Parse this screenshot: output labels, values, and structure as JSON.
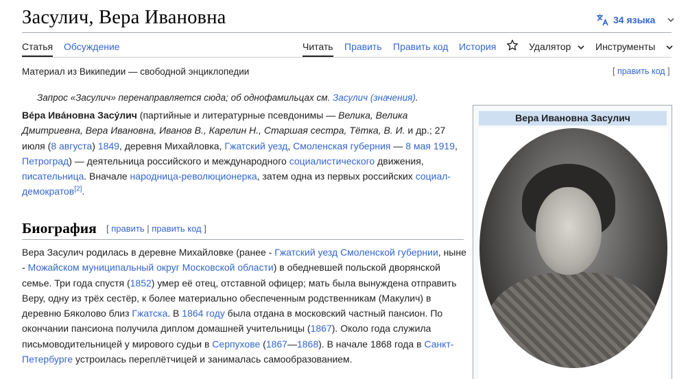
{
  "header": {
    "title": "Засулич, Вера Ивановна",
    "languages_label": "34 языка"
  },
  "tabs": {
    "article": "Статья",
    "talk": "Обсуждение",
    "read": "Читать",
    "edit": "Править",
    "edit_source": "Править код",
    "history": "История",
    "remove": "Удалятор",
    "tools": "Инструменты"
  },
  "subtitle": "Материал из Википедии — свободной энциклопедии",
  "edit_code_link": {
    "open": "[ ",
    "label": "править код",
    "close": " ]"
  },
  "hatnote": {
    "text": "Запрос «Засулич» перенаправляется сюда; об однофамильцах см. ",
    "link": "Засулич (значения)",
    "end": "."
  },
  "lead": {
    "name_bold": "Ве́ра Ива́новна Засу́лич",
    "t1": " (партийные и литературные псевдонимы — ",
    "pseud": "Велика, Велика Дмитриевна, Вера Ивановна, Иванов В., Карелин Н., Старшая сестра, Тётка, В. И.",
    "t2": " и др.; 27 июля (",
    "l_aug8": "8 августа",
    "t3": ") ",
    "l_1849": "1849",
    "t4": ", деревня Михайловка, ",
    "l_gzhatsk": "Гжатский уезд",
    "t5": ", ",
    "l_smolensk": "Смоленская губерния",
    "t6": " — ",
    "l_may8": "8 мая",
    "t7": " ",
    "l_1919": "1919",
    "t8": ", ",
    "l_petrograd": "Петроград",
    "t9": ") — деятельница российского и международного ",
    "l_socialist": "социалистического",
    "t10": " движения, ",
    "l_writer": "писательница",
    "t11": ". Вначале ",
    "l_narod": "народница-революционерка",
    "t12": ", затем одна из первых российских ",
    "l_socdem": "социал-демократов",
    "ref": "[2]",
    "t13": "."
  },
  "infobox": {
    "title": "Вера Ивановна Засулич"
  },
  "section": {
    "heading": "Биография",
    "edit_open": "[ ",
    "edit": "править",
    "sep": " | ",
    "edit_code": "править код",
    "edit_close": " ]"
  },
  "bio": {
    "b1": "Вера Засулич родилась в деревне Михайловке (ранее - ",
    "l_gzh": "Гжатский уезд Смоленской губернии",
    "b2": ", ныне - ",
    "l_mozh": "Можайском муниципальный округ Московской области",
    "b3": ") в обедневшей польской дворянской семье. Три года спустя (",
    "l_1852": "1852",
    "b4": ") умер её отец, отставной офицер; мать была вынуждена отправить Веру, одну из трёх сестёр, к более материально обеспеченным родственникам (Макулич) в деревню Бяколово близ ",
    "l_gzhatsk": "Гжатска",
    "b5": ". В ",
    "l_1864": "1864 году",
    "b6": " была отдана в московский частный пансион. По окончании пансиона получила диплом домашней учительницы (",
    "l_1867": "1867",
    "b7": "). Около года служила письмоводительницей у мирового судьи в ",
    "l_serp": "Серпухове",
    "b8": " (",
    "l_1867b": "1867",
    "b9": "—",
    "l_1868": "1868",
    "b10": "). В начале 1868 года в ",
    "l_spb": "Санкт-Петербурге",
    "b11": " устроилась переплётчицей и занималась самообразованием."
  }
}
